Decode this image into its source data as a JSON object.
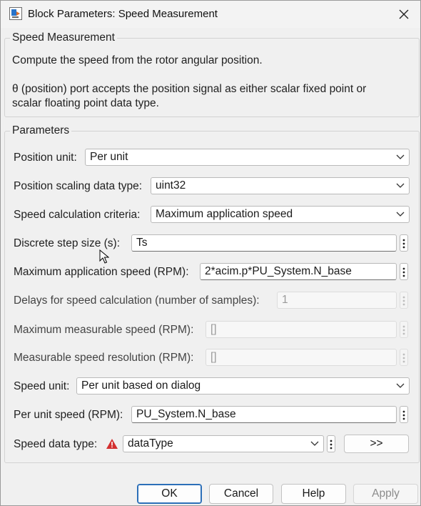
{
  "window": {
    "title": "Block Parameters: Speed Measurement"
  },
  "description": {
    "group_label": "Speed Measurement",
    "line1": "Compute the speed from the rotor angular position.",
    "line2a": "θ (position) port accepts the position signal as either scalar fixed point or",
    "line2b": "scalar floating point data type."
  },
  "params": {
    "group_label": "Parameters",
    "position_unit": {
      "label": "Position unit:",
      "value": "Per unit"
    },
    "position_scaling": {
      "label": "Position scaling data type:",
      "value": "uint32"
    },
    "speed_criteria": {
      "label": "Speed calculation criteria:",
      "value": "Maximum application speed"
    },
    "step_size": {
      "label": "Discrete step size (s):",
      "value": "Ts"
    },
    "max_app_speed": {
      "label": "Maximum application speed (RPM):",
      "value": "2*acim.p*PU_System.N_base"
    },
    "delays": {
      "label": "Delays for speed calculation (number of samples):",
      "value": "1"
    },
    "max_measurable": {
      "label": "Maximum measurable speed (RPM):",
      "value": "[]"
    },
    "resolution": {
      "label": "Measurable speed resolution (RPM):",
      "value": "[]"
    },
    "speed_unit": {
      "label": "Speed unit:",
      "value": "Per unit based on dialog"
    },
    "pu_speed": {
      "label": "Per unit speed (RPM):",
      "value": "PU_System.N_base"
    },
    "speed_dtype": {
      "label": "Speed data type:",
      "value": "dataType",
      "assistant_label": ">>"
    }
  },
  "buttons": {
    "ok": "OK",
    "cancel": "Cancel",
    "help": "Help",
    "apply": "Apply"
  },
  "icons": {
    "app": "simulink-block-icon",
    "close": "close-icon",
    "warning": "warning-triangle-icon",
    "kebab": "vertical-ellipsis-icon",
    "chevron": "chevron-down-icon"
  },
  "colors": {
    "accent": "#2c6fb8",
    "warning": "#d32f2f"
  }
}
